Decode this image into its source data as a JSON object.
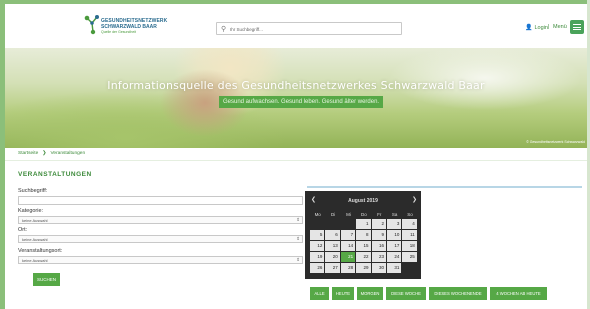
{
  "header": {
    "logo": {
      "line1": "GESUNDHEITSNETZWERK",
      "line2": "SCHWARZWALD BAAR",
      "line3": "Quelle der Gesundheit"
    },
    "search_placeholder": "Ihr Suchbegriff...",
    "login_label": "Login",
    "separator": "|",
    "menu_label": "Menü"
  },
  "hero": {
    "title": "Informationsquelle des Gesundheitsnetzwerkes Schwarzwald Baar",
    "tagline": "Gesund aufwachsen. Gesund leben. Gesund älter werden.",
    "credit": "© Gesundheitsnetzwerk Schwarzwald"
  },
  "breadcrumb": {
    "home": "Startseite",
    "separator": "❯",
    "current": "Veranstaltungen"
  },
  "section_title": "VERANSTALTUNGEN",
  "form": {
    "search_label": "Suchbegriff:",
    "search_value": "",
    "category_label": "Kategorie:",
    "category_value": "keine Auswahl",
    "place_label": "Ort:",
    "place_value": "keine Auswahl",
    "venue_label": "Veranstaltungsort:",
    "venue_value": "keine Auswahl",
    "submit_label": "SUCHEN"
  },
  "calendar": {
    "month": "August 2019",
    "prev": "❮",
    "next": "❯",
    "weekdays": [
      "Mo",
      "Di",
      "Mi",
      "Do",
      "Fr",
      "Sa",
      "So"
    ],
    "weeks": [
      [
        "",
        "",
        "",
        "1",
        "2",
        "3",
        "4"
      ],
      [
        "5",
        "6",
        "7",
        "8",
        "9",
        "10",
        "11"
      ],
      [
        "12",
        "13",
        "14",
        "15",
        "16",
        "17",
        "18"
      ],
      [
        "19",
        "20",
        "21",
        "22",
        "23",
        "24",
        "25"
      ],
      [
        "26",
        "27",
        "28",
        "29",
        "30",
        "31",
        ""
      ]
    ],
    "selected_day": "21"
  },
  "filters": [
    "ALLE",
    "HEUTE",
    "MORGEN",
    "DIESE WOCHE",
    "DIESES WOCHENENDE",
    "4 WOCHEN AB HEUTE"
  ],
  "colors": {
    "brand_green": "#56a846",
    "link_green": "#3c8a3a",
    "logo_blue": "#2b6c8f",
    "calendar_bg": "#2b2b2b"
  }
}
